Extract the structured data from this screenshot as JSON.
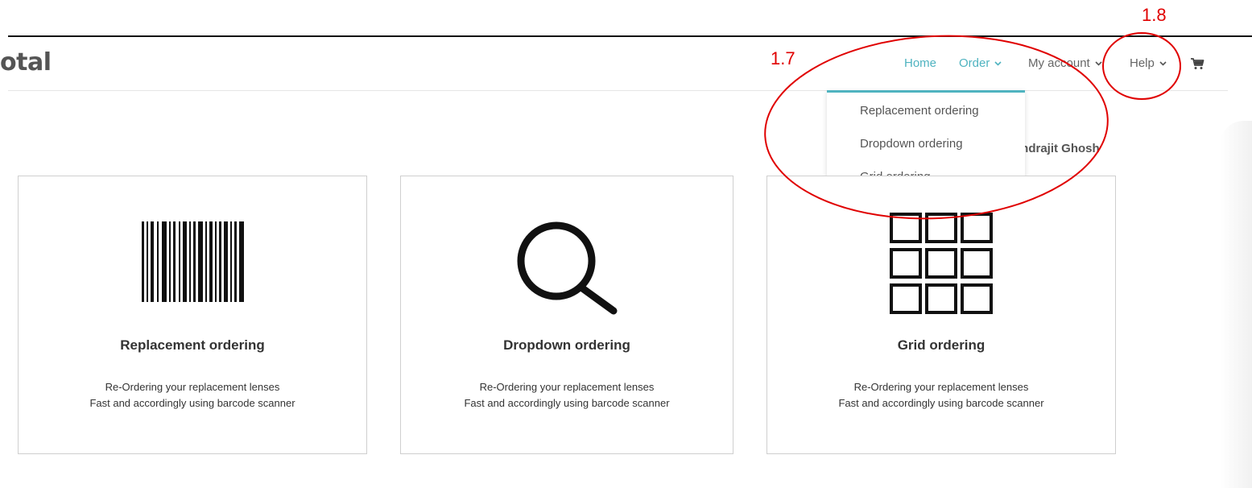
{
  "brand": {
    "logo_text": "otal"
  },
  "nav": {
    "home": "Home",
    "order": "Order",
    "account": "My account",
    "help": "Help"
  },
  "dropdown": {
    "items": [
      "Replacement ordering",
      "Dropdown ordering",
      "Grid ordering"
    ]
  },
  "greeting": "Indrajit Ghosh",
  "cards": [
    {
      "title": "Replacement ordering",
      "desc1": "Re-Ordering your replacement lenses",
      "desc2": "Fast and accordingly using barcode scanner",
      "icon": "barcode-icon"
    },
    {
      "title": "Dropdown ordering",
      "desc1": "Re-Ordering your replacement lenses",
      "desc2": "Fast and accordingly using barcode scanner",
      "icon": "search-icon"
    },
    {
      "title": "Grid ordering",
      "desc1": "Re-Ordering your replacement lenses",
      "desc2": "Fast and accordingly using barcode scanner",
      "icon": "grid-icon"
    }
  ],
  "annotations": {
    "a1": "1.7",
    "a2": "1.8"
  },
  "colors": {
    "accent": "#4fb3c0",
    "annotation": "#e00000"
  }
}
